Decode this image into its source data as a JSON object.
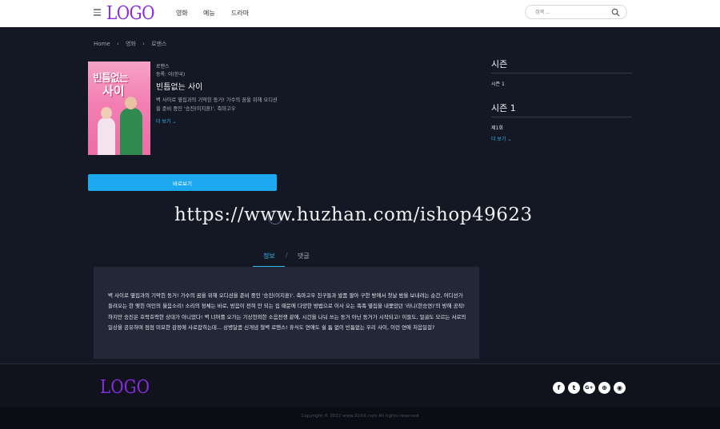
{
  "header": {
    "logo": "LOGO",
    "nav": [
      "영화",
      "예능",
      "드라마"
    ],
    "search_placeholder": "검색 ..."
  },
  "breadcrumb": [
    "Home",
    "›",
    "영화",
    "›",
    "로맨스"
  ],
  "detail": {
    "genre": "로맨스",
    "region": "등록: 이(한국)",
    "title": "빈틈없는 사이",
    "description": "벽 사이로 옆집과의 기막힌 동거! 가수의 꿈을 위해 오디션을 준비 중인 '승진(이지훈)', 축마고우",
    "more_label": "더 보기 ⌄",
    "play_label": "바로보기",
    "poster_title_1": "빈틈없는",
    "poster_title_2": "사이"
  },
  "sidebar": {
    "season_heading": "시즌",
    "season_item": "시즌 1",
    "season1_heading": "시즌 1",
    "episode": "제1회",
    "more_label": "더 보기 ⌄"
  },
  "watermark": "https://www.huzhan.com/ishop49623",
  "tabs": {
    "info": "정보",
    "separator": "/",
    "comments": "댓글"
  },
  "info_text": "벽 사이로 옆집과의 기막힌 동거! 가수의 꿈을 위해 오디션을 준비 중인 '승진(이지훈)'. 축마고우 친구들과 발품 팔아 구한 방에서 첫날 밤을 보내려는 순간, 어디선가 들려오는 한 맺힌 여인의 울음소리! 소리의 정체는 바로, 방음이 전혀 안 되는 집 때문에 다양한 방법으로 이사 오는 족족 옆집을 내쫓았던 '라니(한승연)'의 방해 공작! 하지만 승진은 호락호락한 상대가 아니었다! 벽 너머를 오가는 기상천외한 소음전쟁 끝에, 시간을 나눠 쓰는 동거 아닌 동거가 시작되고! 이들도, 얼굴도 모르는 서로의 일상을 공유하며 점점 미묘한 감정에 사로잡히는데... 상병달콤 신개념 철벽 로맨스! 휴식도 연애도 쉴 틈 없이 빈틈없는 우리 사이, 이런 연애 처음일걸?",
  "footer": {
    "logo": "LOGO",
    "social_icons": [
      "facebook-icon",
      "twitter-icon",
      "google-plus-icon",
      "globe-icon",
      "rss-icon"
    ],
    "copyright": "Copyright © 2022 www.XXXX.com All rights reserved"
  },
  "colors": {
    "accent": "#36b7f0",
    "logo": "#8a2be2",
    "background": "#141824",
    "panel": "#222838"
  }
}
